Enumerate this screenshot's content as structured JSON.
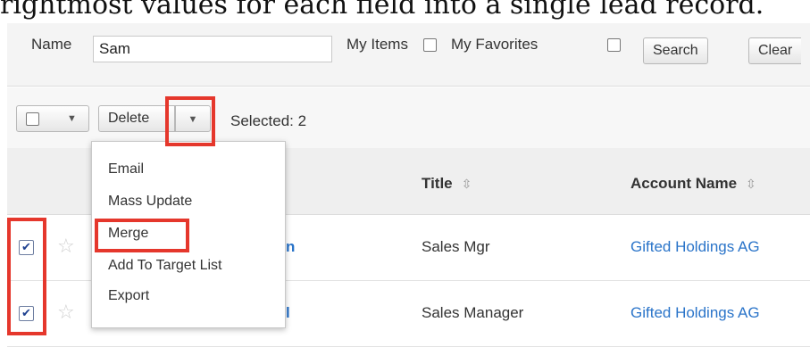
{
  "caption": "rightmost values for each field into a single lead record.",
  "filter": {
    "name_label": "Name",
    "name_value": "Sam",
    "my_items_label": "My Items",
    "my_favorites_label": "My Favorites",
    "search_label": "Search",
    "clear_label": "Clear"
  },
  "toolbar": {
    "delete_label": "Delete",
    "selected_text": "Selected: 2"
  },
  "menu": {
    "items": [
      "Email",
      "Mass Update",
      "Merge",
      "Add To Target List",
      "Export"
    ]
  },
  "columns": {
    "title": "Title",
    "account": "Account Name"
  },
  "rows": [
    {
      "name_fragment": "n",
      "title": "Sales Mgr",
      "account": "Gifted Holdings AG",
      "checked": true
    },
    {
      "name_fragment": "l",
      "title": "Sales Manager",
      "account": "Gifted Holdings AG",
      "checked": true
    }
  ],
  "colors": {
    "highlight": "#e5372c",
    "link": "#2a74c9"
  }
}
